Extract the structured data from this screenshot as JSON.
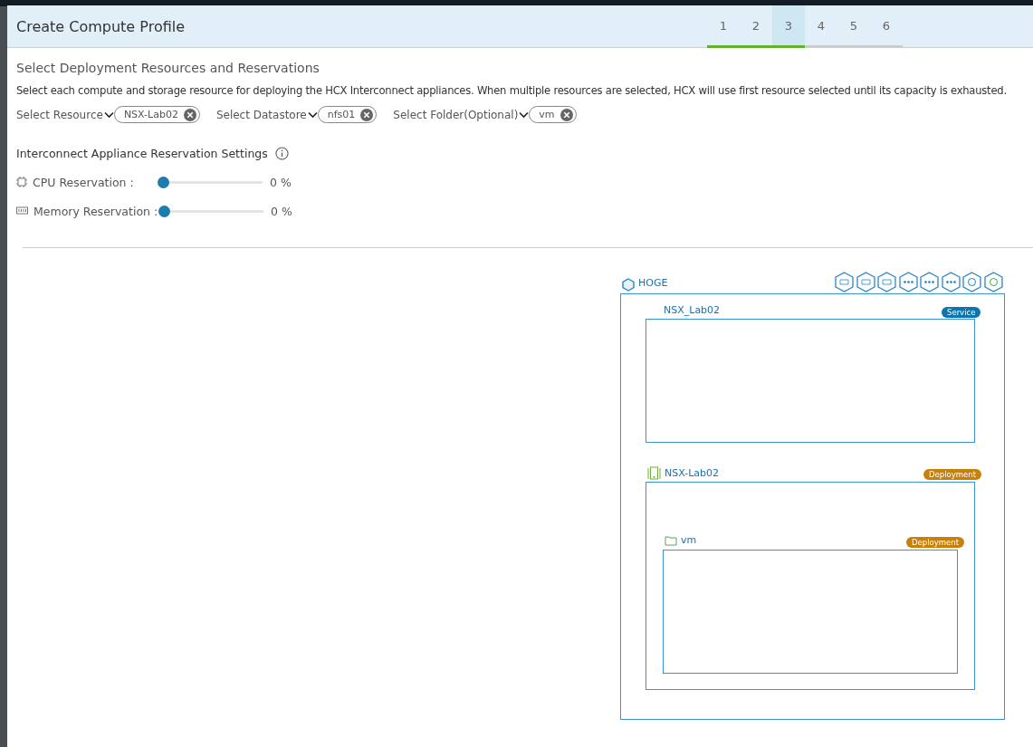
{
  "dialog": {
    "title": "Create Compute Profile"
  },
  "steps": [
    {
      "label": "1",
      "selected": false,
      "done": true
    },
    {
      "label": "2",
      "selected": false,
      "done": true
    },
    {
      "label": "3",
      "selected": true,
      "done": true
    },
    {
      "label": "4",
      "selected": false,
      "done": false
    },
    {
      "label": "5",
      "selected": false,
      "done": false
    },
    {
      "label": "6",
      "selected": false,
      "done": false
    }
  ],
  "section": {
    "title": "Select Deployment Resources and Reservations",
    "description": "Select each compute and storage resource for deploying the HCX Interconnect appliances. When multiple resources are selected, HCX will use first resource selected until its capacity is exhausted."
  },
  "selectors": [
    {
      "label": "Select Resource",
      "value": "NSX-Lab02"
    },
    {
      "label": "Select Datastore",
      "value": "nfs01"
    },
    {
      "label": "Select Folder(Optional)",
      "value": "vm"
    }
  ],
  "reservations": {
    "title": "Interconnect Appliance Reservation Settings",
    "items": [
      {
        "kind": "cpu",
        "label": "CPU Reservation :",
        "level": 0,
        "reading": "0 %"
      },
      {
        "kind": "memory",
        "label": "Memory Reservation :",
        "level": 0,
        "reading": "0 %"
      }
    ]
  },
  "topology": {
    "site": "HOGE",
    "containers": [
      {
        "name": "NSX_Lab02",
        "badge": "Service",
        "kind": "service"
      },
      {
        "name": "NSX-Lab02",
        "badge": "Deployment",
        "kind": "cluster",
        "children": [
          {
            "name": "vm",
            "badge": "Deployment",
            "kind": "folder"
          }
        ]
      }
    ]
  }
}
